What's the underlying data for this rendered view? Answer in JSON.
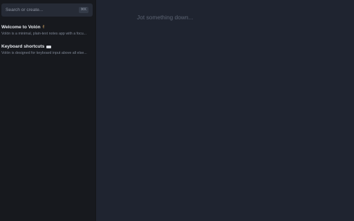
{
  "sidebar": {
    "search": {
      "placeholder": "Search or create...",
      "value": "",
      "shortcut": "⌘K"
    },
    "notes": [
      {
        "title": "Welcome to Volón",
        "emoji": "✌",
        "preview": "Volón is a minimal, plain-text notes app with a focu..."
      },
      {
        "title": "Keyboard shortcuts",
        "emoji": "keyboard",
        "preview": "Volón is designed for keyboard input above all else..."
      }
    ]
  },
  "editor": {
    "placeholder": "Jot something down..."
  },
  "colors": {
    "sidebar_bg": "#17191e",
    "editor_bg": "#1f2430",
    "search_bg": "#262b36"
  }
}
